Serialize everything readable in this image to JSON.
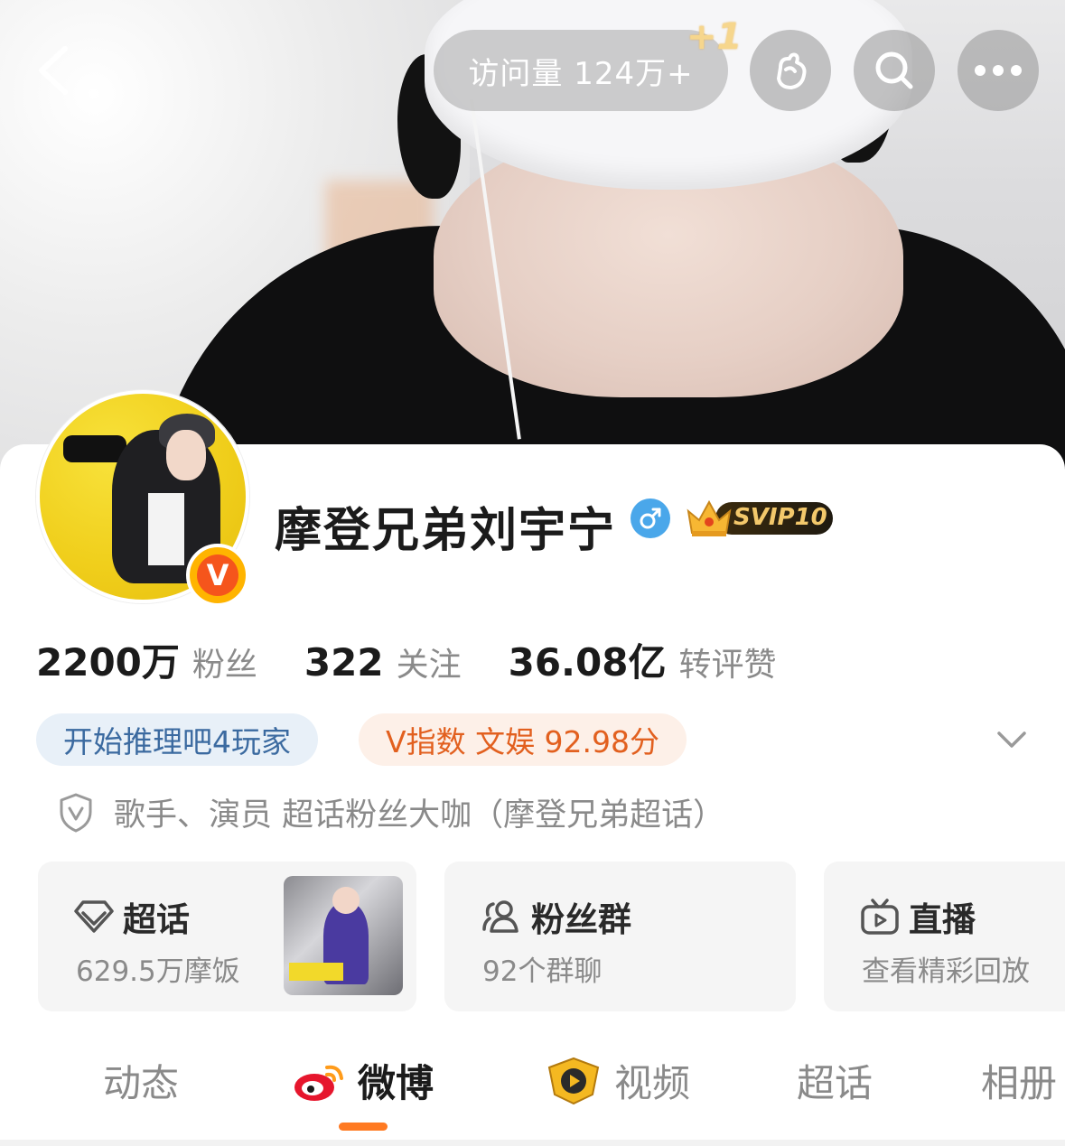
{
  "header": {
    "visits_label": "访问量 124万+",
    "plus_one": "+1"
  },
  "profile": {
    "name": "摩登兄弟刘宇宁",
    "vip_label": "SVIP10",
    "verified_badge": "V",
    "gender": "male"
  },
  "stats": [
    {
      "value": "2200万",
      "label": "粉丝"
    },
    {
      "value": "322",
      "label": "关注"
    },
    {
      "value": "36.08亿",
      "label": "转评赞"
    }
  ],
  "tags": {
    "game": "开始推理吧4玩家",
    "vindex": "V指数 文娱 92.98分"
  },
  "verification": "歌手、演员 超话粉丝大咖（摩登兄弟超话）",
  "features": [
    {
      "title": "超话",
      "subtitle": "629.5万摩饭"
    },
    {
      "title": "粉丝群",
      "subtitle": "92个群聊"
    },
    {
      "title": "直播",
      "subtitle": "查看精彩回放"
    }
  ],
  "tabs": [
    {
      "label": "动态",
      "active": false
    },
    {
      "label": "微博",
      "active": true
    },
    {
      "label": "视频",
      "active": false
    },
    {
      "label": "超话",
      "active": false
    },
    {
      "label": "相册",
      "active": false
    }
  ],
  "colors": {
    "accent": "#ff7a22",
    "verified": "#f5551c",
    "tag_blue_text": "#3b6aa0",
    "tag_orange_text": "#e2601f",
    "male": "#4aa7ea"
  }
}
